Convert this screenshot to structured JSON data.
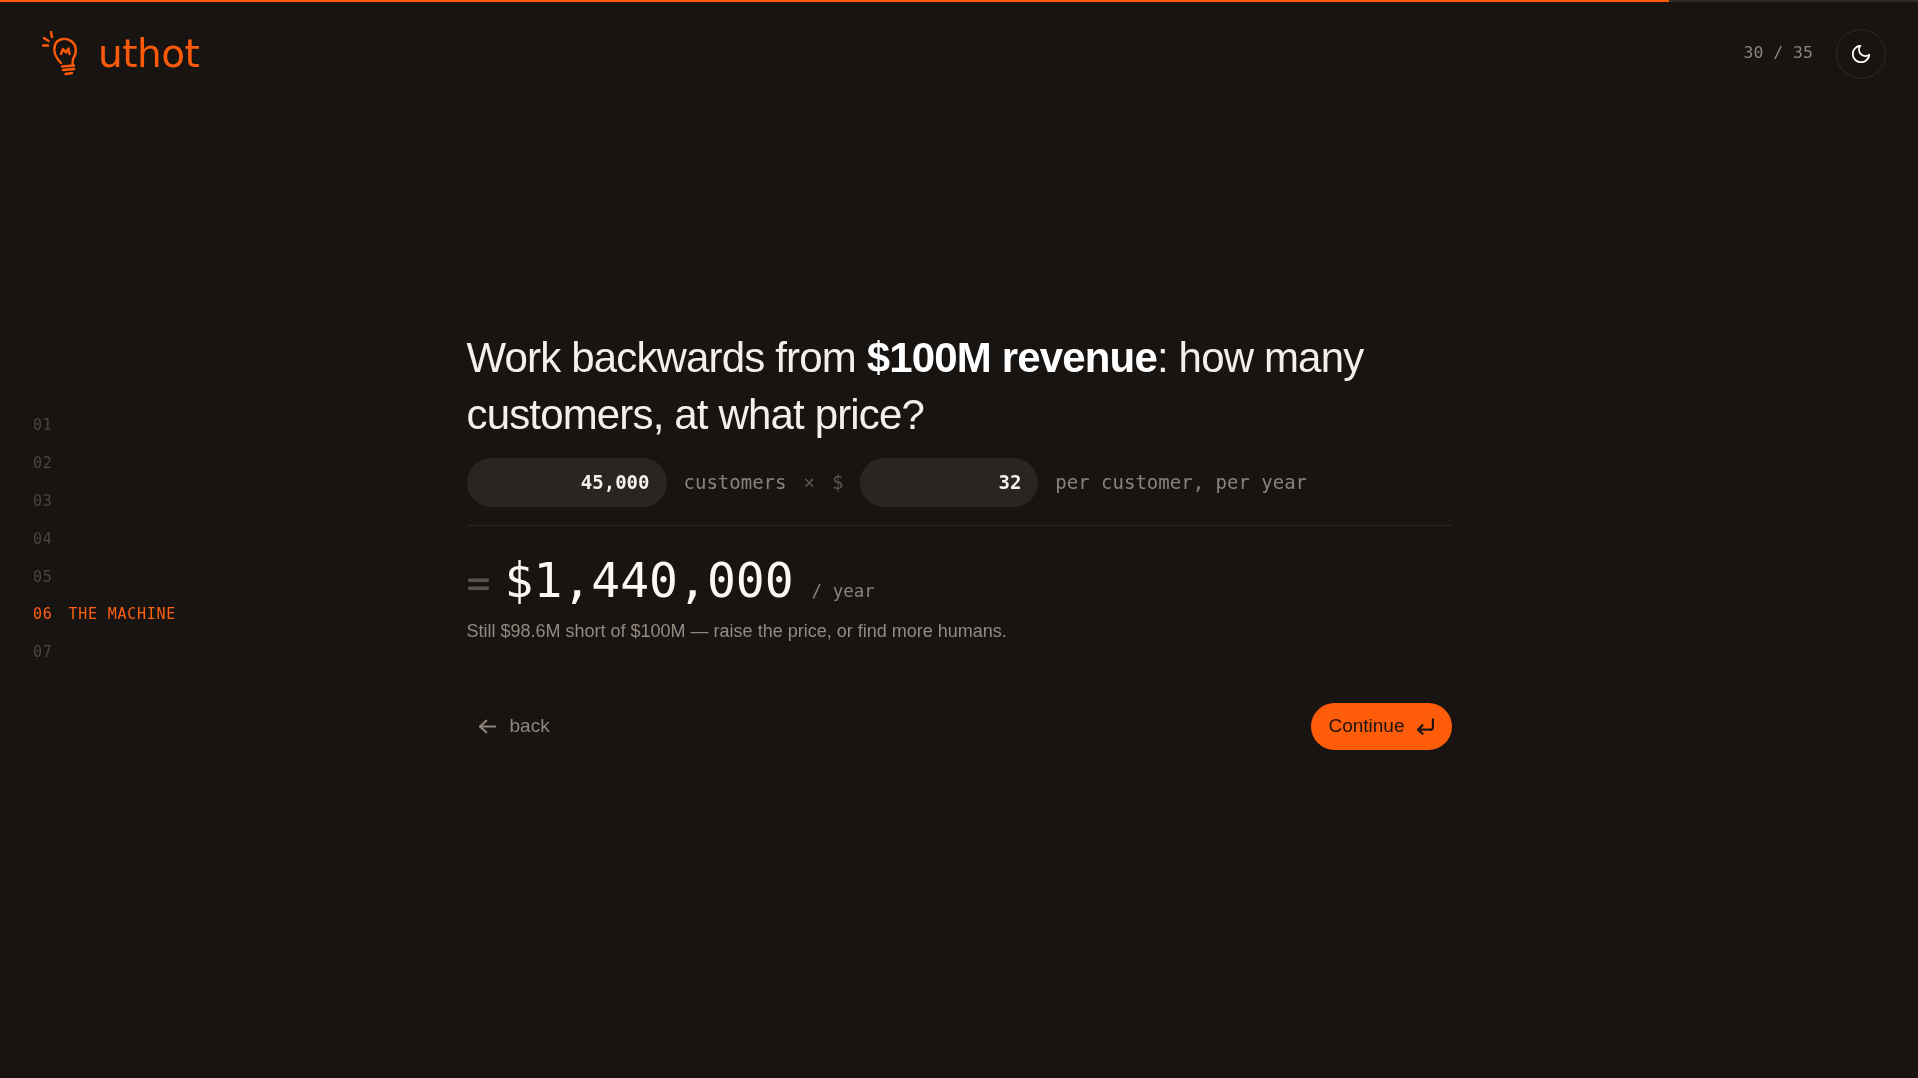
{
  "progress": {
    "level": 0.87
  },
  "brand": {
    "name": "uthot"
  },
  "counter": "30 / 35",
  "sections": [
    {
      "number": "01",
      "selected": false
    },
    {
      "number": "02",
      "selected": false
    },
    {
      "number": "03",
      "selected": false
    },
    {
      "number": "04",
      "selected": false
    },
    {
      "number": "05",
      "selected": false
    },
    {
      "number": "06",
      "title": "THE MACHINE",
      "selected": true
    },
    {
      "number": "07",
      "selected": false
    }
  ],
  "question": "Work backwards from **$100M revenue**: how many customers, at what price?",
  "equation": [
    {
      "kind": "field",
      "value": "45,000"
    },
    {
      "kind": "label",
      "text": "customers"
    },
    {
      "kind": "symbol",
      "text": "×"
    },
    {
      "kind": "symbol",
      "text": "$"
    },
    {
      "kind": "field",
      "value": "32"
    },
    {
      "kind": "label",
      "text": "per customer, per year"
    }
  ],
  "result": {
    "sign": "=",
    "amount": "$1,440,000",
    "unit": "/ year"
  },
  "note": "Still $98.6M short of $100M — raise the price, or find more humans.",
  "buttons": [
    {
      "kind": "back",
      "label": "back"
    },
    {
      "kind": "continue",
      "label": "Continue"
    }
  ]
}
